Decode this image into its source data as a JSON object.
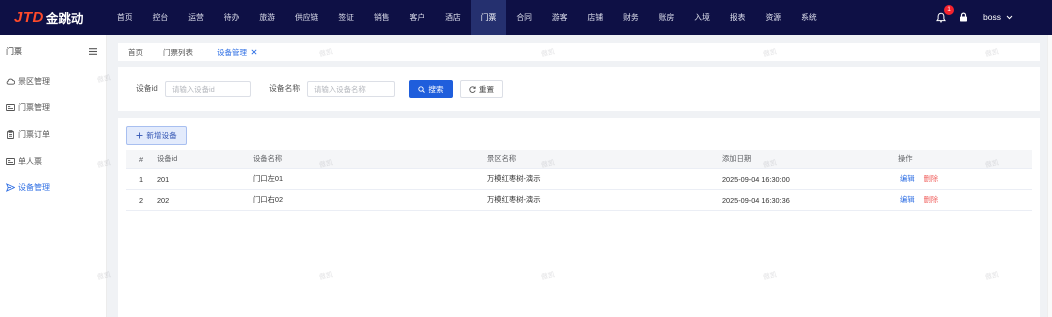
{
  "brand": {
    "mark": "JTD",
    "name": "金跳动"
  },
  "topnav": {
    "items": [
      {
        "label": "首页"
      },
      {
        "label": "控台"
      },
      {
        "label": "运营"
      },
      {
        "label": "待办"
      },
      {
        "label": "旅游"
      },
      {
        "label": "供应链"
      },
      {
        "label": "签证"
      },
      {
        "label": "销售"
      },
      {
        "label": "客户"
      },
      {
        "label": "酒店"
      },
      {
        "label": "门票",
        "active": true
      },
      {
        "label": "合同"
      },
      {
        "label": "游客"
      },
      {
        "label": "店铺"
      },
      {
        "label": "财务"
      },
      {
        "label": "账房"
      },
      {
        "label": "入境"
      },
      {
        "label": "报表"
      },
      {
        "label": "资源"
      },
      {
        "label": "系统"
      }
    ]
  },
  "header_right": {
    "notification_icon": "bell-icon",
    "notification_count": "1",
    "lock_icon": "lock-icon",
    "user_name": "boss",
    "user_menu_icon": "chevron-down-icon"
  },
  "sidebar": {
    "title": "门票",
    "toggle_icon": "menu-icon",
    "items": [
      {
        "label": "景区管理",
        "icon": "scenic-area-icon"
      },
      {
        "label": "门票管理",
        "icon": "ticket-card-icon"
      },
      {
        "label": "门票订单",
        "icon": "clipboard-icon"
      },
      {
        "label": "单人票",
        "icon": "ticket-card-icon"
      },
      {
        "label": "设备管理",
        "icon": "send-icon",
        "active": true
      }
    ]
  },
  "tabs": [
    {
      "label": "首页"
    },
    {
      "label": "门票列表"
    },
    {
      "label": "设备管理",
      "active": true,
      "close_icon": "close-icon"
    }
  ],
  "search_form": {
    "device_id": {
      "label": "设备id",
      "placeholder": "请输入设备id",
      "value": ""
    },
    "device_name": {
      "label": "设备名称",
      "placeholder": "请输入设备名称",
      "value": ""
    },
    "search_button": {
      "label": "搜索",
      "icon": "search-icon"
    },
    "reset_button": {
      "label": "重置",
      "icon": "refresh-icon"
    }
  },
  "device_table": {
    "add_button": {
      "label": "新增设备",
      "icon": "plus-icon"
    },
    "columns": [
      "#",
      "设备id",
      "设备名称",
      "景区名称",
      "添加日期",
      "操作"
    ],
    "rows": [
      {
        "index": "1",
        "device_id": "201",
        "device_name": "门口左01",
        "scenic_area": "万模红枣树-演示",
        "added_date": "2025-09-04 16:30:00",
        "actions": {
          "edit": "编辑",
          "delete": "删除"
        }
      },
      {
        "index": "2",
        "device_id": "202",
        "device_name": "门口右02",
        "scenic_area": "万模红枣树-演示",
        "added_date": "2025-09-04 16:30:36",
        "actions": {
          "edit": "编辑",
          "delete": "删除"
        }
      }
    ]
  },
  "watermark": {
    "text": "傲凯"
  },
  "colors": {
    "topbar_bg": "#0e1045",
    "topbar_active_bg": "#25306f",
    "accent": "#2f6fe4",
    "primary_button": "#1f5edc",
    "danger": "#f0625f",
    "brand_mark": "#ff4a2a",
    "page_bg": "#f0f2f5",
    "badge": "#f5222d"
  }
}
